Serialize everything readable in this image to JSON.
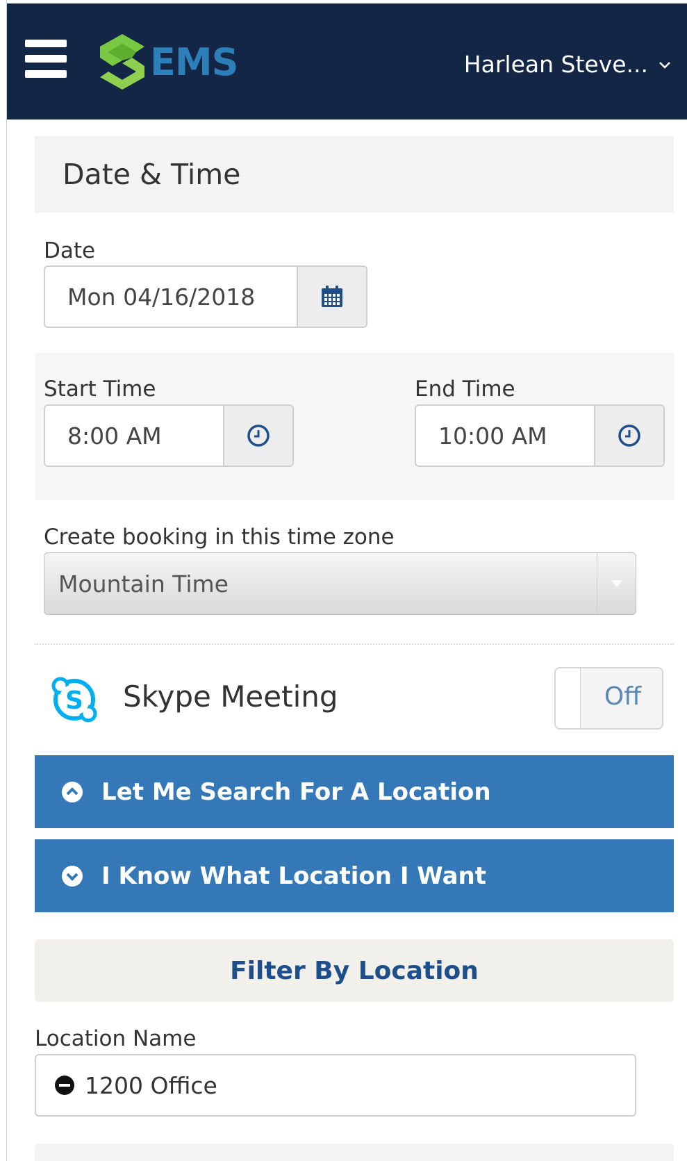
{
  "header": {
    "logo_text": "EMS",
    "user_name": "Harlean Steve..."
  },
  "section": {
    "title": "Date & Time"
  },
  "date": {
    "label": "Date",
    "value": "Mon 04/16/2018"
  },
  "start_time": {
    "label": "Start Time",
    "value": "8:00 AM"
  },
  "end_time": {
    "label": "End Time",
    "value": "10:00 AM"
  },
  "timezone": {
    "label": "Create booking in this time zone",
    "selected": "Mountain Time"
  },
  "skype": {
    "label": "Skype Meeting",
    "toggle_state": "Off"
  },
  "accordions": {
    "search_location": "Let Me Search For A Location",
    "know_location": "I Know What Location I Want"
  },
  "filter": {
    "label": "Filter By Location"
  },
  "location": {
    "label": "Location Name",
    "value": "1200 Office"
  },
  "colors": {
    "header_bg": "#142645",
    "accent_blue": "#3478b8",
    "logo_green": "#7ac943",
    "logo_blue": "#2c7fb8",
    "skype_blue": "#00aff0"
  },
  "icons": [
    "hamburger-icon",
    "ems-logo-icon",
    "chevron-down-icon",
    "calendar-icon",
    "clock-icon",
    "dropdown-arrow-icon",
    "skype-icon",
    "chevron-up-circle-icon",
    "chevron-down-circle-icon",
    "minus-circle-icon"
  ]
}
